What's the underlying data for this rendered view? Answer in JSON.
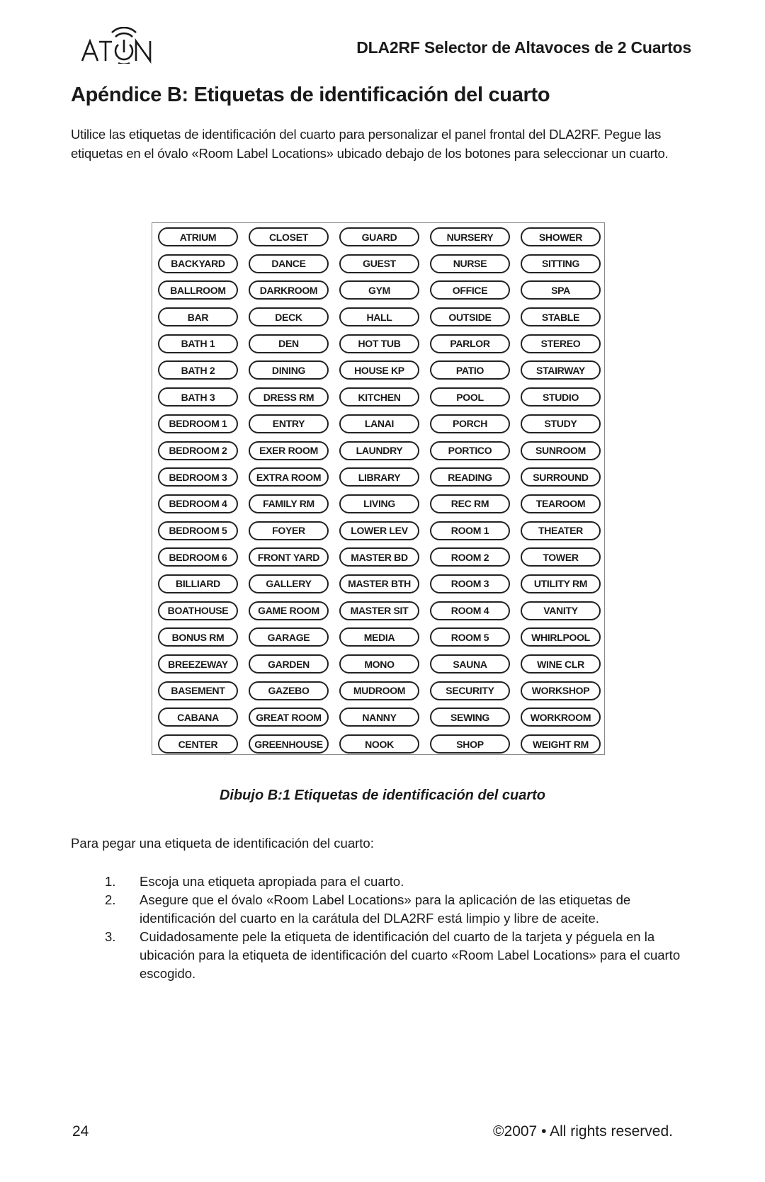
{
  "header": {
    "logo_text": "ATON",
    "title": "DLA2RF Selector de Altavoces de 2 Cuartos"
  },
  "page_title": "Apéndice B: Etiquetas de identificación del cuarto",
  "intro": "Utilice las etiquetas de identificación del cuarto para personalizar el panel frontal del DLA2RF. Pegue las etiquetas en el óvalo «Room Label Locations» ubicado debajo de los botones para seleccionar un cuarto.",
  "labels": [
    [
      "ATRIUM",
      "CLOSET",
      "GUARD",
      "NURSERY",
      "SHOWER"
    ],
    [
      "BACKYARD",
      "DANCE",
      "GUEST",
      "NURSE",
      "SITTING"
    ],
    [
      "BALLROOM",
      "DARKROOM",
      "GYM",
      "OFFICE",
      "SPA"
    ],
    [
      "BAR",
      "DECK",
      "HALL",
      "OUTSIDE",
      "STABLE"
    ],
    [
      "BATH 1",
      "DEN",
      "HOT TUB",
      "PARLOR",
      "STEREO"
    ],
    [
      "BATH 2",
      "DINING",
      "HOUSE KP",
      "PATIO",
      "STAIRWAY"
    ],
    [
      "BATH 3",
      "DRESS RM",
      "KITCHEN",
      "POOL",
      "STUDIO"
    ],
    [
      "BEDROOM 1",
      "ENTRY",
      "LANAI",
      "PORCH",
      "STUDY"
    ],
    [
      "BEDROOM 2",
      "EXER ROOM",
      "LAUNDRY",
      "PORTICO",
      "SUNROOM"
    ],
    [
      "BEDROOM 3",
      "EXTRA ROOM",
      "LIBRARY",
      "READING",
      "SURROUND"
    ],
    [
      "BEDROOM 4",
      "FAMILY RM",
      "LIVING",
      "REC RM",
      "TEAROOM"
    ],
    [
      "BEDROOM 5",
      "FOYER",
      "LOWER LEV",
      "ROOM 1",
      "THEATER"
    ],
    [
      "BEDROOM 6",
      "FRONT YARD",
      "MASTER BD",
      "ROOM 2",
      "TOWER"
    ],
    [
      "BILLIARD",
      "GALLERY",
      "MASTER BTH",
      "ROOM 3",
      "UTILITY RM"
    ],
    [
      "BOATHOUSE",
      "GAME ROOM",
      "MASTER SIT",
      "ROOM 4",
      "VANITY"
    ],
    [
      "BONUS RM",
      "GARAGE",
      "MEDIA",
      "ROOM 5",
      "WHIRLPOOL"
    ],
    [
      "BREEZEWAY",
      "GARDEN",
      "MONO",
      "SAUNA",
      "WINE CLR"
    ],
    [
      "BASEMENT",
      "GAZEBO",
      "MUDROOM",
      "SECURITY",
      "WORKSHOP"
    ],
    [
      "CABANA",
      "GREAT ROOM",
      "NANNY",
      "SEWING",
      "WORKROOM"
    ],
    [
      "CENTER",
      "GREENHOUSE",
      "NOOK",
      "SHOP",
      "WEIGHT RM"
    ]
  ],
  "caption": "Dibujo B:1 Etiquetas de identificación del cuarto",
  "instructions": {
    "lead": "Para pegar una etiqueta de identificación del cuarto:",
    "steps": [
      {
        "num": "1.",
        "text": "Escoja una etiqueta apropiada para el cuarto."
      },
      {
        "num": "2.",
        "text": "Asegure que el óvalo «Room Label Locations» para la aplicación de las etiquetas de identificación del cuarto en la carátula del DLA2RF está limpio y libre de aceite."
      },
      {
        "num": "3.",
        "text": "Cuidadosamente pele la etiqueta de identificación del cuarto de la tarjeta y péguela en la ubicación para la etiqueta de identificación del cuarto «Room Label Locations» para el cuarto escogido."
      }
    ]
  },
  "footer": {
    "page_number": "24",
    "copyright": "©2007 • All rights reserved."
  }
}
